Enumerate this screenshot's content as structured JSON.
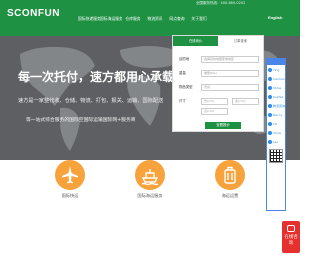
{
  "header": {
    "logo": "SCONFUN",
    "hotline": "全国服务热线：400-660-0202",
    "nav": [
      "国际快递服务",
      "国际海运服务",
      "仓库服务",
      "物流资讯",
      "网点查询",
      "关于我们"
    ],
    "language": "English"
  },
  "hero": {
    "title": "每一次托付，速方都用心承载",
    "subtitle": "速方是一家整代收、仓储、物流、打包、报关、运输、国际配送",
    "subtitle2": "等一站式综合服务的国际空国际运输国际网+服务商"
  },
  "quote_form": {
    "tabs": [
      "在线询价",
      "订单查询"
    ],
    "fields": [
      {
        "label": "目的地",
        "placeholder": "选择目的地国家或地区"
      },
      {
        "label": "重量",
        "placeholder": "重量(KG)"
      },
      {
        "label": "物品类型",
        "placeholder": "普货"
      },
      {
        "label": "尺寸",
        "placeholder": "长(cm)",
        "placeholder2": "宽(cm)"
      },
      {
        "label": "",
        "placeholder": "高(cm)"
      }
    ],
    "submit": "查看报价"
  },
  "online_service": {
    "agents": [
      "Ying",
      "Carmen",
      "Shine",
      "Sophia",
      "物流咨询",
      "Nancy",
      "Lili",
      "Show",
      "Leo"
    ]
  },
  "services": [
    "国际快运",
    "国际海运服务",
    "海运运费"
  ],
  "chat": {
    "label": "在线咨询"
  },
  "colors": {
    "brand": "#1e9143",
    "accent": "#f7a23b",
    "chat": "#e5302d",
    "service_blue": "#4a86e8"
  }
}
